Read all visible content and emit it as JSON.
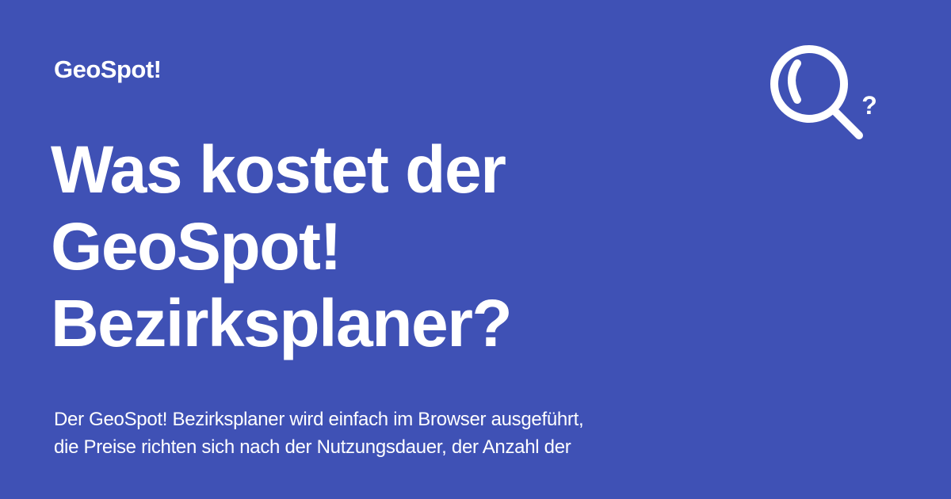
{
  "brand": "GeoSpot!",
  "title": {
    "lines": [
      "Was kostet der",
      "GeoSpot!",
      "Bezirksplaner?"
    ]
  },
  "description": {
    "lines": [
      "Der GeoSpot! Bezirksplaner wird einfach im Browser ausgeführt,",
      "die Preise richten sich nach der Nutzungsdauer, der Anzahl der"
    ]
  },
  "icon": {
    "name": "search-question-icon",
    "question_mark": "?"
  },
  "colors": {
    "background": "#3f51b5",
    "foreground": "#ffffff"
  }
}
